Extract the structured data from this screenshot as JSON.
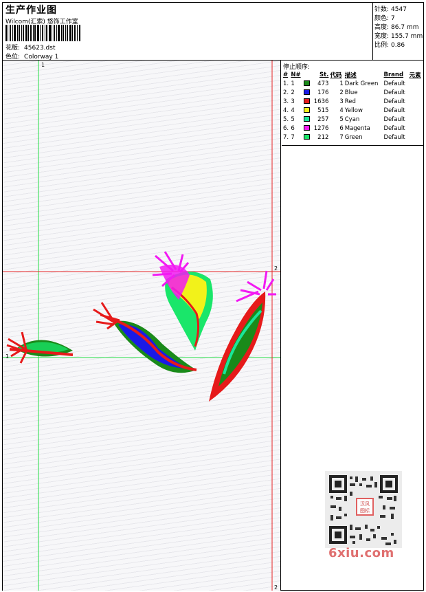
{
  "header": {
    "title": "生产作业图",
    "studio": "Wilcom(汇索) 悠饰工作室",
    "design_label": "花版:",
    "design_value": "45623.dst",
    "colorway_label": "色位:",
    "colorway_value": "Colorway 1"
  },
  "stats": {
    "stitches_label": "针数:",
    "stitches_value": "4547",
    "colors_label": "颜色:",
    "colors_value": "7",
    "height_label": "高度:",
    "height_value": "86.7 mm",
    "width_label": "宽度:",
    "width_value": "155.7 mm",
    "scale_label": "比例:",
    "scale_value": "0.86"
  },
  "canvas": {
    "marker_top": "1",
    "marker_left": "1",
    "marker_right_mid": "2",
    "marker_right_bottom": "2"
  },
  "stop_sequence": {
    "title": "停止顺序:",
    "columns": [
      "#",
      "N#",
      "St.",
      "代码",
      "描述",
      "Brand",
      "元素"
    ],
    "rows": [
      {
        "idx": "1.",
        "n": "1",
        "stitches": "473",
        "code": "1",
        "description": "Dark Green",
        "brand": "Default",
        "color": "#1a8a1a"
      },
      {
        "idx": "2.",
        "n": "2",
        "stitches": "176",
        "code": "2",
        "description": "Blue",
        "brand": "Default",
        "color": "#1a1ae6"
      },
      {
        "idx": "3.",
        "n": "3",
        "stitches": "1636",
        "code": "3",
        "description": "Red",
        "brand": "Default",
        "color": "#e61a1a"
      },
      {
        "idx": "4.",
        "n": "4",
        "stitches": "515",
        "code": "4",
        "description": "Yellow",
        "brand": "Default",
        "color": "#f2f21a"
      },
      {
        "idx": "5.",
        "n": "5",
        "stitches": "257",
        "code": "5",
        "description": "Cyan",
        "brand": "Default",
        "color": "#1ae69a"
      },
      {
        "idx": "6.",
        "n": "6",
        "stitches": "1276",
        "code": "6",
        "description": "Magenta",
        "brand": "Default",
        "color": "#f21af2"
      },
      {
        "idx": "7.",
        "n": "7",
        "stitches": "212",
        "code": "7",
        "description": "Green",
        "brand": "Default",
        "color": "#1ae66a"
      }
    ]
  },
  "qr": {
    "stamp_text": "汉风 图标"
  },
  "watermark": "6xiu.com"
}
